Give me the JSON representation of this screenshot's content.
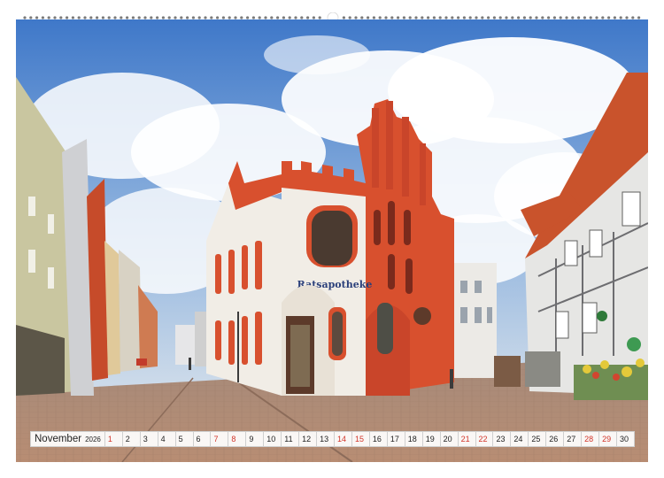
{
  "calendar": {
    "month": "November",
    "year": "2026",
    "days": [
      {
        "n": "1",
        "weekend": true
      },
      {
        "n": "2",
        "weekend": false
      },
      {
        "n": "3",
        "weekend": false
      },
      {
        "n": "4",
        "weekend": false
      },
      {
        "n": "5",
        "weekend": false
      },
      {
        "n": "6",
        "weekend": false
      },
      {
        "n": "7",
        "weekend": true
      },
      {
        "n": "8",
        "weekend": true
      },
      {
        "n": "9",
        "weekend": false
      },
      {
        "n": "10",
        "weekend": false
      },
      {
        "n": "11",
        "weekend": false
      },
      {
        "n": "12",
        "weekend": false
      },
      {
        "n": "13",
        "weekend": false
      },
      {
        "n": "14",
        "weekend": true
      },
      {
        "n": "15",
        "weekend": true
      },
      {
        "n": "16",
        "weekend": false
      },
      {
        "n": "17",
        "weekend": false
      },
      {
        "n": "18",
        "weekend": false
      },
      {
        "n": "19",
        "weekend": false
      },
      {
        "n": "20",
        "weekend": false
      },
      {
        "n": "21",
        "weekend": true
      },
      {
        "n": "22",
        "weekend": true
      },
      {
        "n": "23",
        "weekend": false
      },
      {
        "n": "24",
        "weekend": false
      },
      {
        "n": "25",
        "weekend": false
      },
      {
        "n": "26",
        "weekend": false
      },
      {
        "n": "27",
        "weekend": false
      },
      {
        "n": "28",
        "weekend": true
      },
      {
        "n": "29",
        "weekend": true
      },
      {
        "n": "30",
        "weekend": false
      }
    ]
  },
  "photo": {
    "building_sign": "Ratsapotheke",
    "colors": {
      "sky": "#4f86cf",
      "facade_red": "#d8502e",
      "facade_white": "#f1ede6",
      "pavement": "#b58e77",
      "weekend_text": "#d2352a"
    }
  }
}
